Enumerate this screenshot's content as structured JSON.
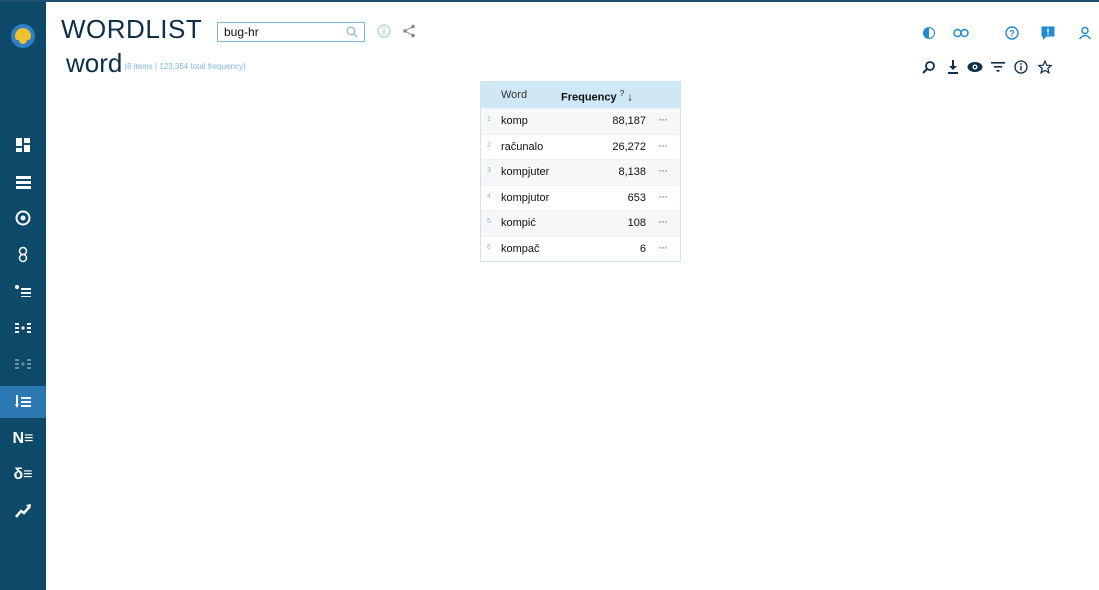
{
  "app": {
    "title": "WORDLIST"
  },
  "search": {
    "value": "bug-hr",
    "placeholder": ""
  },
  "header": {
    "subtitle": "word",
    "meta": "(6 items | 123,364 total frequency)"
  },
  "sidebar": {
    "items": [
      {
        "name": "dashboard",
        "label": ""
      },
      {
        "name": "list",
        "label": ""
      },
      {
        "name": "target",
        "label": ""
      },
      {
        "name": "link",
        "label": ""
      },
      {
        "name": "wordlist-bullet",
        "label": ""
      },
      {
        "name": "parallel",
        "label": ""
      },
      {
        "name": "parallel-dim",
        "label": ""
      },
      {
        "name": "wordlist-sort",
        "label": ""
      },
      {
        "name": "ngram",
        "label": "N≡"
      },
      {
        "name": "keywords",
        "label": "δ≡"
      },
      {
        "name": "trends",
        "label": ""
      }
    ]
  },
  "table": {
    "columns": {
      "word": "Word",
      "frequency": "Frequency",
      "frequency_help": "?",
      "sort_arrow": "↓"
    },
    "rows": [
      {
        "idx": "1",
        "word": "komp",
        "freq": "88,187",
        "more": "···"
      },
      {
        "idx": "2",
        "word": "računalo",
        "freq": "26,272",
        "more": "···"
      },
      {
        "idx": "3",
        "word": "kompjuter",
        "freq": "8,138",
        "more": "···"
      },
      {
        "idx": "4",
        "word": "kompjutor",
        "freq": "653",
        "more": "···"
      },
      {
        "idx": "5",
        "word": "kompić",
        "freq": "108",
        "more": "···"
      },
      {
        "idx": "6",
        "word": "kompač",
        "freq": "6",
        "more": "···"
      }
    ]
  },
  "colors": {
    "sidebar": "#0d4a69",
    "active": "#2b78b3",
    "accent": "#1f8ad1",
    "table_header": "#cfe8f5"
  }
}
